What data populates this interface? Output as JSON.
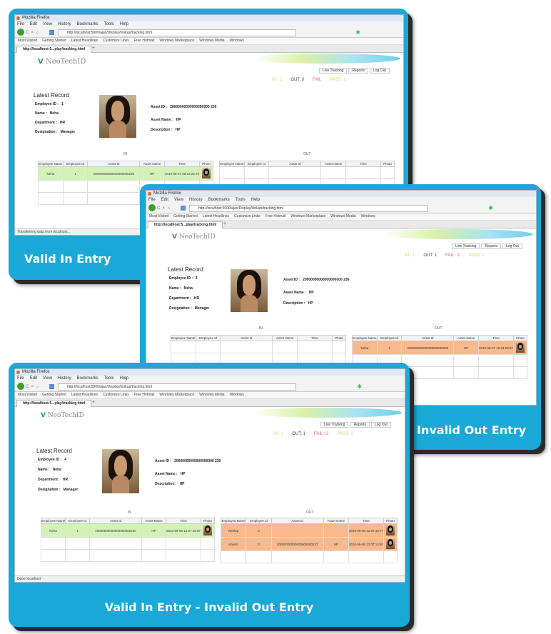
{
  "browser": {
    "title": "Mozilla Firefox",
    "menu": [
      "File",
      "Edit",
      "View",
      "History",
      "Bookmarks",
      "Tools",
      "Help"
    ],
    "url": "http://localhost:5000/ajax/Display/lookup/tracking.html",
    "bookmarks": [
      "Most Visited",
      "Getting Started",
      "Latest Headlines",
      "Customize Links",
      "Free Hotmail",
      "Windows Marketplace",
      "Windows Media",
      "Windows"
    ],
    "tab": "http://localhost:5...play/tracking.html",
    "tab_plus": "+"
  },
  "app": {
    "logo_mark": "V",
    "logo_text": "NeoTechID",
    "nav": [
      "Live Tracking",
      "Reports",
      "Log Out"
    ],
    "latest_title": "Latest Record",
    "labels": {
      "employee_id": "Employee ID :",
      "name": "Name :",
      "department": "Department :",
      "designation": "Designation :",
      "asset_id": "Asset ID :",
      "asset_name": "Asset Name :",
      "description": "Description :"
    },
    "in_label": "IN",
    "out_label": "OUT",
    "columns": [
      "Employee Name",
      "Employee Id",
      "Asset Id",
      "Asset Name",
      "Time",
      "Photo"
    ]
  },
  "cards": [
    {
      "caption": "Valid In Entry",
      "counters": {
        "in": "IN : 1",
        "out": "OUT: 0",
        "fail": "FAIL",
        "pass": "PASS: 1"
      },
      "record": {
        "employee_id": "1",
        "name": "Neha",
        "department": "HR",
        "designation": "Manager",
        "asset_id": "20000000000000000000 230",
        "asset_name": "HP",
        "description": "HP"
      },
      "in_rows": [
        {
          "emp_name": "Neha",
          "emp_id": "1",
          "asset_id": "20000000000000000000230",
          "asset_name": "HP",
          "time": "2010-06-07 08:02:22:70"
        }
      ],
      "out_rows": [],
      "status": "Transferring data from localhost..."
    },
    {
      "caption": "Invalid Out Entry",
      "counters": {
        "in": "IN : 1",
        "out": "OUT: 1",
        "fail": "FAIL : 1",
        "pass": "PASS: 1"
      },
      "record": {
        "employee_id": "1",
        "name": "Neha",
        "department": "HR",
        "designation": "Manager",
        "asset_id": "20000000000000000000 230",
        "asset_name": "HP",
        "description": "HP"
      },
      "in_rows": [],
      "out_rows": [
        {
          "emp_name": "Neha",
          "emp_id": "1",
          "asset_id": "20000000000000000000230",
          "asset_name": "HP",
          "time": "2010-06-07 12:34:00:87"
        }
      ],
      "status": ""
    },
    {
      "caption": "Valid In Entry - Invalid Out Entry",
      "counters": {
        "in": "IN : 1",
        "out": "OUT: 1",
        "fail": "FAIL : 2",
        "pass": "PASS: 1"
      },
      "record": {
        "employee_id": "4",
        "name": "Neha",
        "department": "HR",
        "designation": "Manager",
        "asset_id": "20000000000000000000 230",
        "asset_name": "HP",
        "description": "HP"
      },
      "in_rows": [
        {
          "emp_name": "Neha",
          "emp_id": "1",
          "asset_id": "20000000000000000000230",
          "asset_name": "HP",
          "time": "2010-06-08 12:07:10:87"
        }
      ],
      "out_rows": [
        {
          "emp_name": "Neelap",
          "emp_id": "2",
          "asset_id": "",
          "asset_name": "",
          "time": "2010-06-08 12:07:15:77"
        },
        {
          "emp_name": "Kavish",
          "emp_id": "3",
          "asset_id": "20000000000000000000237",
          "asset_name": "HP",
          "time": "2010-06-08 12:07:14:60"
        }
      ],
      "status": "Done localhost"
    }
  ],
  "colors": {
    "card_blue": "#1aa9d6",
    "in_row": "#d6f1b8",
    "out_row": "#f7b98e",
    "fail": "#e06060",
    "pass": "#d9d468"
  }
}
